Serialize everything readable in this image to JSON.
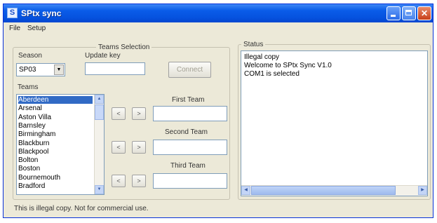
{
  "window": {
    "title": "SPtx sync"
  },
  "menu": {
    "items": [
      "File",
      "Setup"
    ]
  },
  "teams_selection": {
    "legend": "Teams Selection",
    "season_label": "Season",
    "season_value": "SP03",
    "update_key_label": "Update key",
    "update_key_value": "",
    "connect_label": "Connect",
    "teams_label": "Teams",
    "teams": [
      "Aberdeen",
      "Arsenal",
      "Aston Villa",
      "Barnsley",
      "Birmingham",
      "Blackburn",
      "Blackpool",
      "Bolton",
      "Boston",
      "Bournemouth",
      "Bradford"
    ],
    "selected_team": "Aberdeen",
    "slots": [
      {
        "label": "First Team",
        "value": ""
      },
      {
        "label": "Second Team",
        "value": ""
      },
      {
        "label": "Third Team",
        "value": ""
      }
    ],
    "move_left_label": "<",
    "move_right_label": ">"
  },
  "status": {
    "legend": "Status",
    "lines": [
      "Illegal copy",
      "Welcome to SPtx Sync V1.0",
      "COM1 is selected"
    ]
  },
  "statusbar": {
    "text": "This is illegal copy. Not for commercial use."
  }
}
